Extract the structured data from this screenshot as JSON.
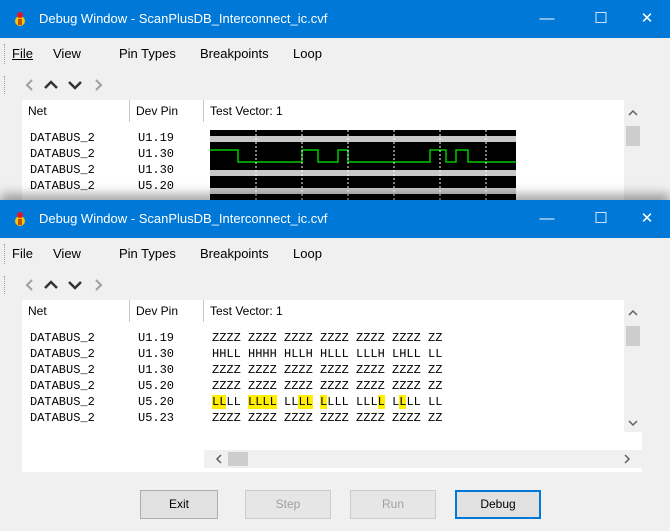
{
  "windows": [
    {
      "title": "Debug Window - ScanPlusDB_Interconnect_ic.cvf",
      "menu": [
        "File",
        "View",
        "Pin Types",
        "Breakpoints",
        "Loop"
      ],
      "columns": [
        "Net",
        "Dev Pin",
        "Test Vector: 1"
      ],
      "rows": [
        {
          "net": "DATABUS_2",
          "pin": "U1.19"
        },
        {
          "net": "DATABUS_2",
          "pin": "U1.30"
        },
        {
          "net": "DATABUS_2",
          "pin": "U1.30"
        },
        {
          "net": "DATABUS_2",
          "pin": "U5.20"
        }
      ],
      "waveform_color": "#00c800"
    },
    {
      "title": "Debug Window - ScanPlusDB_Interconnect_ic.cvf",
      "menu": [
        "File",
        "View",
        "Pin Types",
        "Breakpoints",
        "Loop"
      ],
      "columns": [
        "Net",
        "Dev Pin",
        "Test Vector: 1"
      ],
      "rows": [
        {
          "net": "DATABUS_2",
          "pin": "U1.19",
          "vector": "ZZZZ ZZZZ ZZZZ ZZZZ ZZZZ ZZZZ ZZ"
        },
        {
          "net": "DATABUS_2",
          "pin": "U1.30",
          "vector": "HHLL HHHH HLLH HLLL LLLH LHLL LL"
        },
        {
          "net": "DATABUS_2",
          "pin": "U1.30",
          "vector": "ZZZZ ZZZZ ZZZZ ZZZZ ZZZZ ZZZZ ZZ"
        },
        {
          "net": "DATABUS_2",
          "pin": "U5.20",
          "vector": "ZZZZ ZZZZ ZZZZ ZZZZ ZZZZ ZZZZ ZZ"
        },
        {
          "net": "DATABUS_2",
          "pin": "U5.20",
          "vector": "LLLL LLLL LLLL LLLL LLLL LLLL LL"
        },
        {
          "net": "DATABUS_2",
          "pin": "U5.23",
          "vector": "ZZZZ ZZZZ ZZZZ ZZZZ ZZZZ ZZZZ ZZ"
        }
      ],
      "highlight_color": "#ffee00"
    }
  ],
  "buttons": [
    {
      "label": "Exit",
      "enabled": true
    },
    {
      "label": "Step",
      "enabled": false
    },
    {
      "label": "Run",
      "enabled": false
    },
    {
      "label": "Debug",
      "enabled": true,
      "default": true
    }
  ],
  "theme": {
    "titlebar": "#0078d7",
    "chrome": "#f0f0f0"
  }
}
